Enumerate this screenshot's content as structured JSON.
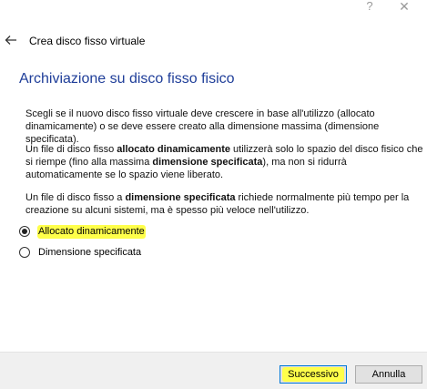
{
  "titlebar": {
    "help": "?",
    "close": "✕"
  },
  "header": {
    "title": "Crea disco fisso virtuale",
    "back_icon": "back-arrow-icon"
  },
  "main": {
    "heading": "Archiviazione su disco fisso fisico",
    "p1": "Scegli se il nuovo disco fisso virtuale deve crescere in base all'utilizzo (allocato dinamicamente) o se deve essere creato alla dimensione massima (dimensione specificata).",
    "p2": {
      "a": "Un file di disco fisso ",
      "b": "allocato dinamicamente",
      "c": " utilizzerà solo lo spazio del disco fisico che si riempe (fino alla massima ",
      "d": "dimensione specificata",
      "e": "), ma non si ridurrà automaticamente se lo spazio viene liberato."
    },
    "p3": {
      "a": "Un file di disco fisso a ",
      "b": "dimensione specificata",
      "c": " richiede normalmente più tempo per la creazione su alcuni sistemi, ma è spesso più veloce nell'utilizzo."
    },
    "options": [
      {
        "label": "Allocato dinamicamente",
        "selected": true,
        "highlighted": true
      },
      {
        "label": "Dimensione specificata",
        "selected": false,
        "highlighted": false
      }
    ]
  },
  "footer": {
    "next_label": "Successivo",
    "cancel_label": "Annulla"
  },
  "colors": {
    "heading": "#1f3e99",
    "highlight": "#ffff4a",
    "focus_border": "#0078d7"
  }
}
